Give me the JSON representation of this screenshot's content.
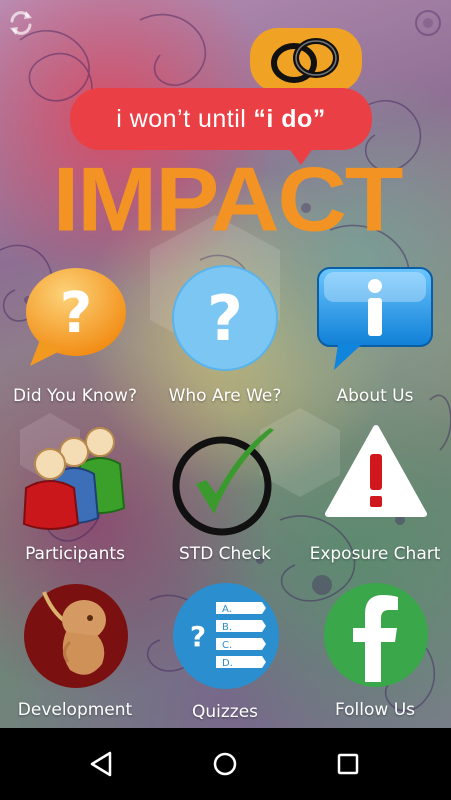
{
  "header": {
    "tagline_prefix": "i won’t until",
    "tagline_emphasis": "“i do”",
    "title": "IMPACT",
    "refresh_icon": "refresh-icon"
  },
  "tiles": [
    {
      "label": "Did You Know?",
      "icon": "orange-question-bubble-icon"
    },
    {
      "label": "Who Are We?",
      "icon": "blue-question-circle-icon"
    },
    {
      "label": "About Us",
      "icon": "info-bubble-icon"
    },
    {
      "label": "Participants",
      "icon": "people-group-icon"
    },
    {
      "label": "STD Check",
      "icon": "checkmark-circle-icon"
    },
    {
      "label": "Exposure Chart",
      "icon": "warning-triangle-icon"
    },
    {
      "label": "Development",
      "icon": "fetus-icon"
    },
    {
      "label": "Quizzes",
      "icon": "quiz-checklist-icon"
    },
    {
      "label": "Follow Us",
      "icon": "facebook-icon"
    }
  ],
  "quiz_options": [
    "A.",
    "B.",
    "C.",
    "D."
  ],
  "colors": {
    "logo_red": "#ea3f45",
    "logo_orange": "#f39323",
    "question_blue": "#58b9ee",
    "check_green": "#3a9a2d",
    "facebook_green": "#3aa74a"
  },
  "navbar": {
    "back_icon": "back-triangle-icon",
    "home_icon": "home-circle-icon",
    "recents_icon": "recents-square-icon"
  }
}
